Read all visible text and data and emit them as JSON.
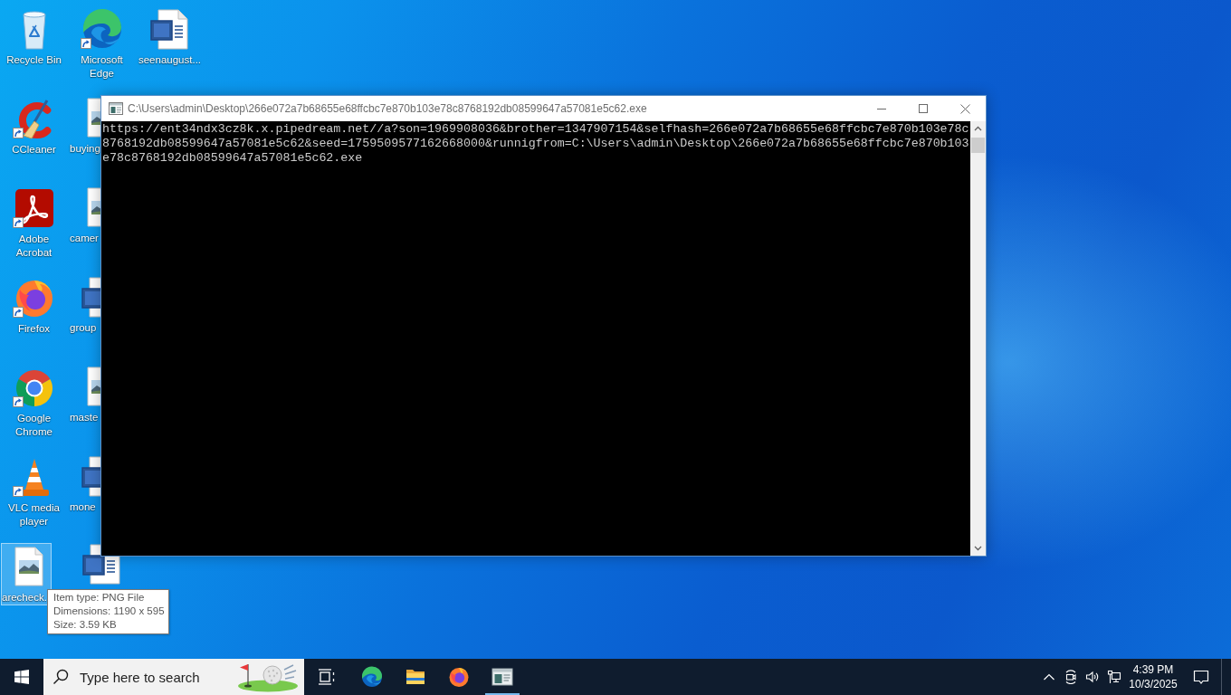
{
  "desktop": {
    "columns": [
      {
        "icons": [
          {
            "label": "Recycle Bin",
            "kind": "recycle",
            "shortcut": false,
            "selected": false
          },
          {
            "label": "CCleaner",
            "kind": "ccleaner",
            "shortcut": true,
            "selected": false
          },
          {
            "label": "Adobe Acrobat",
            "kind": "acrobat",
            "shortcut": true,
            "selected": false
          },
          {
            "label": "Firefox",
            "kind": "firefox",
            "shortcut": true,
            "selected": false
          },
          {
            "label": "Google Chrome",
            "kind": "chrome",
            "shortcut": true,
            "selected": false
          },
          {
            "label": "VLC media player",
            "kind": "vlc",
            "shortcut": true,
            "selected": false
          },
          {
            "label": "arecheck.",
            "kind": "image",
            "shortcut": false,
            "selected": true
          }
        ]
      },
      {
        "icons": [
          {
            "label": "Microsoft Edge",
            "kind": "edge",
            "shortcut": true,
            "selected": false
          },
          {
            "label": "buying",
            "kind": "image",
            "shortcut": false,
            "selected": false
          },
          {
            "label": "camer",
            "kind": "image",
            "shortcut": false,
            "selected": false
          },
          {
            "label": "group",
            "kind": "word",
            "shortcut": false,
            "selected": false
          },
          {
            "label": "maste",
            "kind": "image",
            "shortcut": false,
            "selected": false
          },
          {
            "label": "mone",
            "kind": "word",
            "shortcut": false,
            "selected": false
          },
          {
            "kind": "word",
            "shortcut": false,
            "selected": false
          }
        ]
      },
      {
        "icons": [
          {
            "label": "seenaugust...",
            "kind": "word",
            "shortcut": false,
            "selected": false
          }
        ]
      }
    ]
  },
  "window": {
    "title": "C:\\Users\\admin\\Desktop\\266e072a7b68655e68ffcbc7e870b103e78c8768192db08599647a57081e5c62.exe",
    "output": "https://ent34ndx3cz8k.x.pipedream.net//a?son=1969908036&brother=1347907154&selfhash=266e072a7b68655e68ffcbc7e870b103e78c8768192db08599647a57081e5c62&seed=1759509577162668000&runnigfrom=C:\\Users\\admin\\Desktop\\266e072a7b68655e68ffcbc7e870b103e78c8768192db08599647a57081e5c62.exe"
  },
  "tooltip": {
    "lines": [
      "Item type: PNG File",
      "Dimensions: 1190 x 595",
      "Size: 3.59 KB"
    ]
  },
  "taskbar": {
    "search": {
      "placeholder": "Type here to search"
    },
    "apps": [
      {
        "kind": "edge",
        "active": false
      },
      {
        "kind": "explorer",
        "active": false
      },
      {
        "kind": "firefox",
        "active": false
      },
      {
        "kind": "console",
        "active": true
      }
    ],
    "clock": {
      "time": "4:39 PM",
      "date": "10/3/2025"
    }
  }
}
